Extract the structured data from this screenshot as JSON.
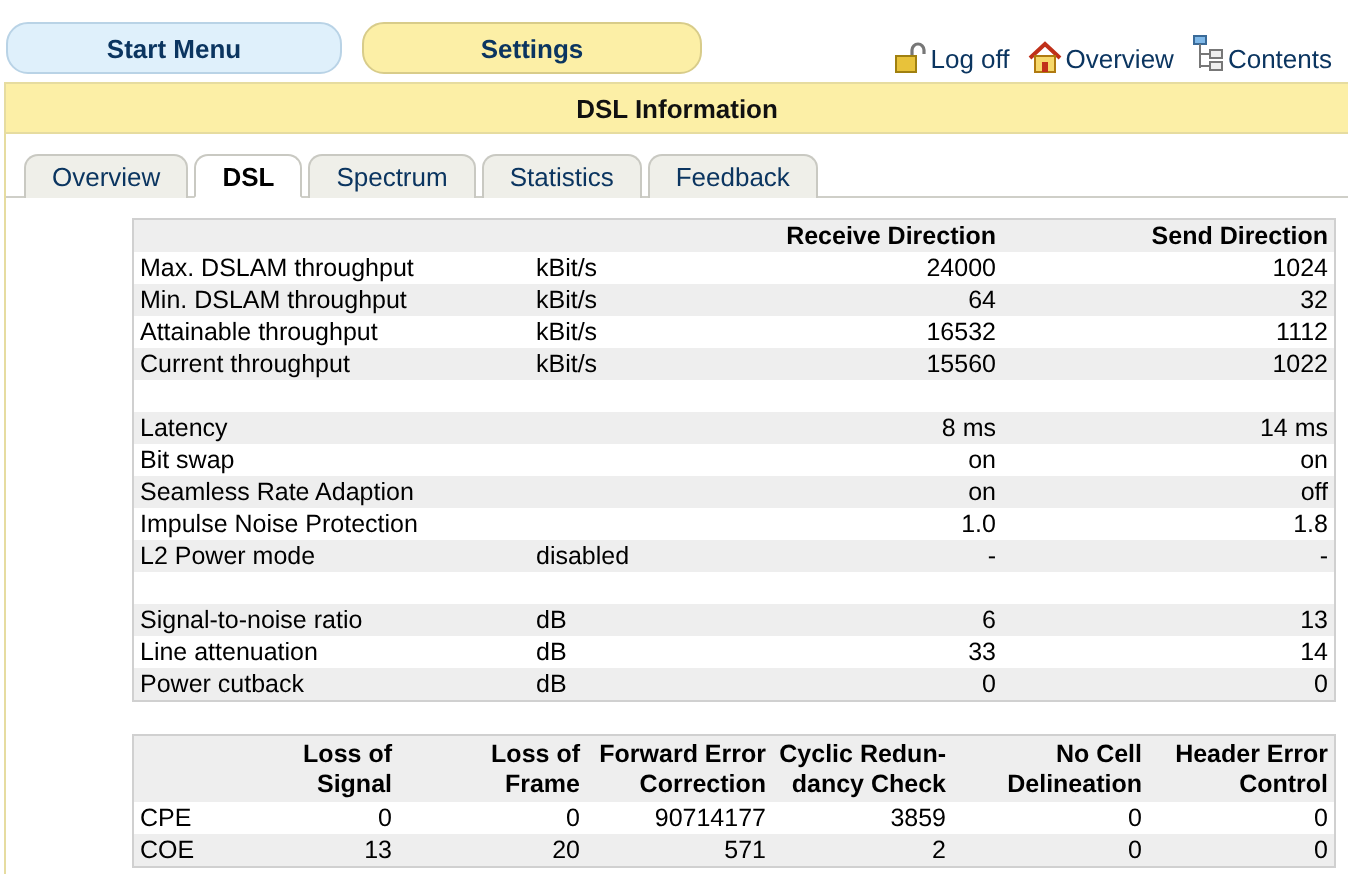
{
  "nav_buttons": [
    {
      "label": "Start Menu",
      "selected": false
    },
    {
      "label": "Settings",
      "selected": true
    }
  ],
  "links": [
    {
      "kind": "lock",
      "label": "Log off"
    },
    {
      "kind": "house",
      "label": "Overview"
    },
    {
      "kind": "tree",
      "label": "Contents"
    }
  ],
  "panel": {
    "title": "DSL Information"
  },
  "tabs": [
    {
      "label": "Overview",
      "selected": false
    },
    {
      "label": "DSL",
      "selected": true
    },
    {
      "label": "Spectrum",
      "selected": false
    },
    {
      "label": "Statistics",
      "selected": false
    },
    {
      "label": "Feedback",
      "selected": false
    }
  ],
  "line_table": {
    "columns": [
      "Receive Direction",
      "Send Direction"
    ],
    "rows": [
      {
        "kind": "data",
        "label": "Max. DSLAM throughput",
        "unit": "kBit/s",
        "receive": "24000",
        "send": "1024"
      },
      {
        "kind": "data",
        "label": "Min. DSLAM throughput",
        "unit": "kBit/s",
        "receive": "64",
        "send": "32"
      },
      {
        "kind": "data",
        "label": "Attainable throughput",
        "unit": "kBit/s",
        "receive": "16532",
        "send": "1112"
      },
      {
        "kind": "data",
        "label": "Current throughput",
        "unit": "kBit/s",
        "receive": "15560",
        "send": "1022"
      },
      {
        "kind": "spacer"
      },
      {
        "kind": "data",
        "label": "Latency",
        "receive": "8 ms",
        "send": "14 ms"
      },
      {
        "kind": "data",
        "label": "Bit swap",
        "receive": "on",
        "send": "on"
      },
      {
        "kind": "data",
        "label": "Seamless Rate Adaption",
        "receive": "on",
        "send": "off"
      },
      {
        "kind": "data",
        "label": "Impulse Noise Protection",
        "receive": "1.0",
        "send": "1.8"
      },
      {
        "kind": "data",
        "label": "L2 Power mode",
        "unit": "disabled",
        "receive": "-",
        "send": "-"
      },
      {
        "kind": "spacer"
      },
      {
        "kind": "data",
        "label": "Signal-to-noise ratio",
        "unit": "dB",
        "receive": "6",
        "send": "13"
      },
      {
        "kind": "data",
        "label": "Line attenuation",
        "unit": "dB",
        "receive": "33",
        "send": "14"
      },
      {
        "kind": "data",
        "label": "Power cutback",
        "unit": "dB",
        "receive": "0",
        "send": "0"
      }
    ]
  },
  "error_table": {
    "columns": [
      [
        "Loss of",
        "Signal"
      ],
      [
        "Loss of",
        "Frame"
      ],
      [
        "Forward Error",
        "Correction"
      ],
      [
        "Cyclic Redun-",
        "dancy Check"
      ],
      [
        "No Cell",
        "Delineation"
      ],
      [
        "Header Error",
        "Control"
      ]
    ],
    "rows": [
      {
        "label": "CPE",
        "values": [
          "0",
          "0",
          "90714177",
          "3859",
          "0",
          "0"
        ]
      },
      {
        "label": "COE",
        "values": [
          "13",
          "20",
          "571",
          "2",
          "0",
          "0"
        ]
      }
    ]
  }
}
